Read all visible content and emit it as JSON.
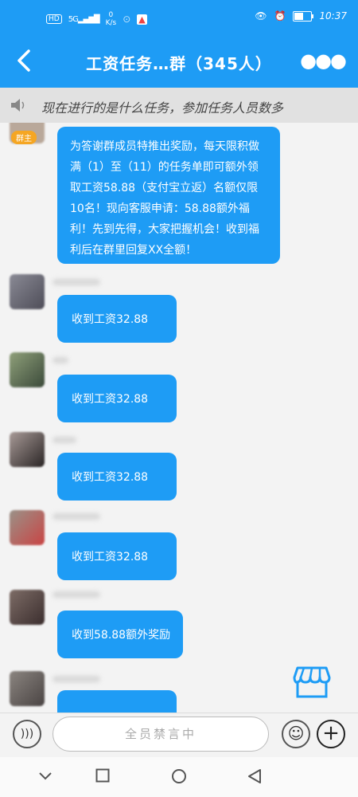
{
  "status_bar": {
    "network_badge": "HD",
    "signal": "5G",
    "net_speed_value": "0",
    "net_speed_unit": "K/s",
    "time": "10:37",
    "battery_level": 0.55
  },
  "header": {
    "title": "工资任务…群（345人）",
    "back_icon": "chevron-left-icon",
    "more_icon": "more-horizontal-icon"
  },
  "announcement": {
    "text": "现在进行的是什么任务，参加任务人员数多"
  },
  "messages": [
    {
      "sender_badge": "群主",
      "text": "为答谢群成员特推出奖励，每天限积做满（1）至（11）的任务单即可额外领取工资58.88（支付宝立返）名额仅限10名！现向客服申请：58.88额外福利！先到先得，大家把握机会！收到福利后在群里回复XX全额！"
    },
    {
      "text": "收到工资32.88"
    },
    {
      "text": "收到工资32.88"
    },
    {
      "text": "收到工资32.88"
    },
    {
      "text": "收到工资32.88"
    },
    {
      "text": "收到58.88额外奖励"
    }
  ],
  "input_bar": {
    "placeholder": "全员禁言中"
  },
  "colors": {
    "accent": "#1e9cf5",
    "badge": "#f5a623"
  }
}
